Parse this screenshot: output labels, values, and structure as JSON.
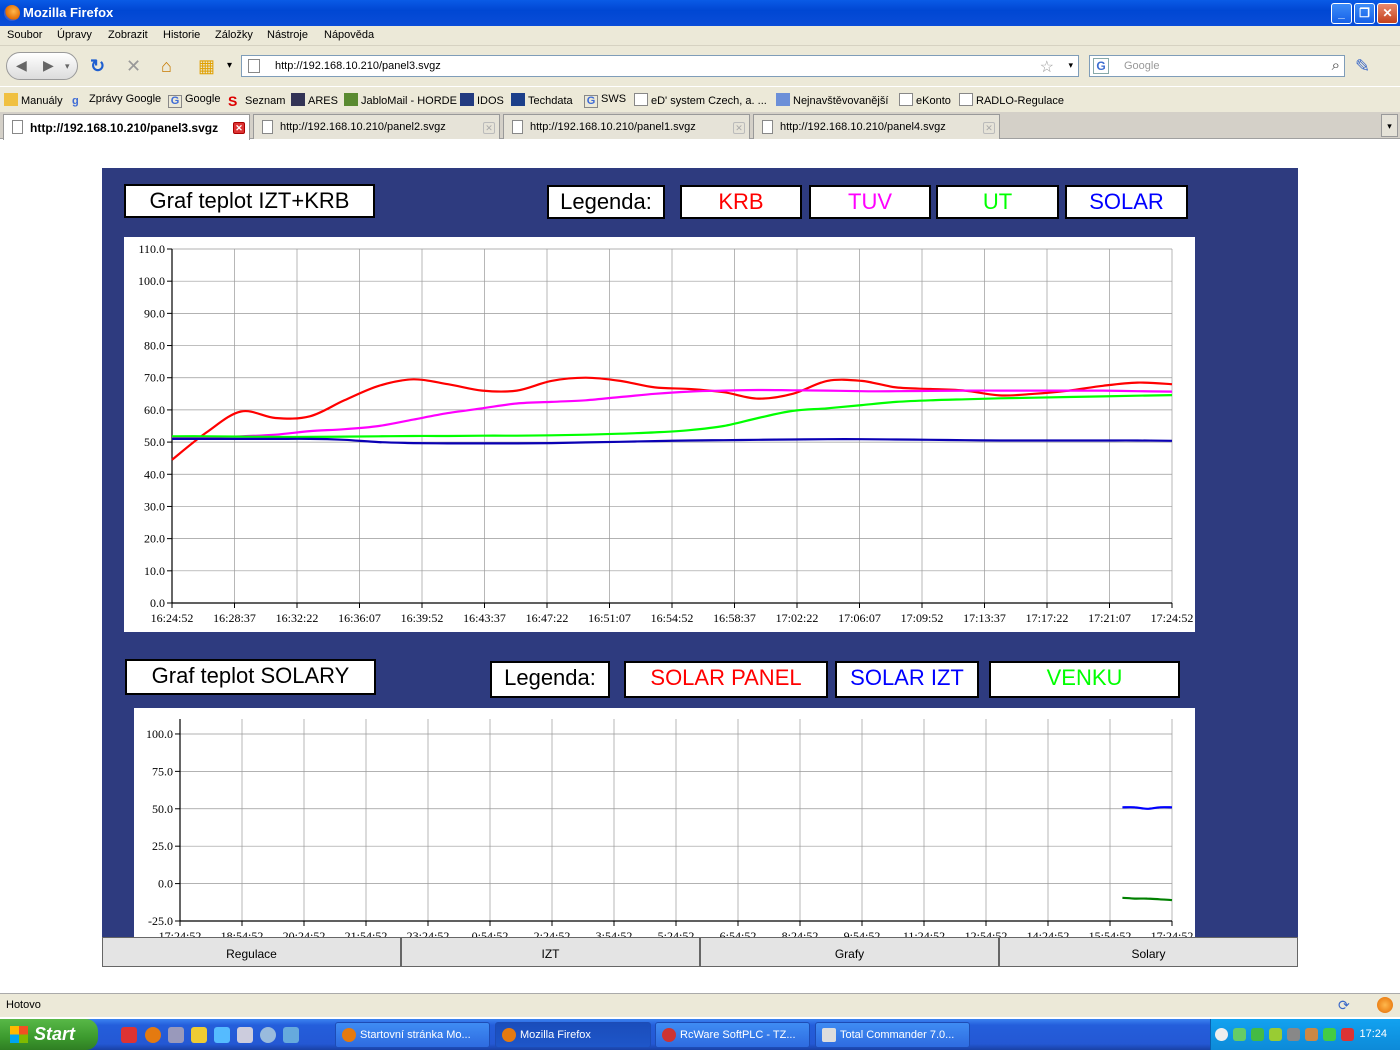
{
  "window": {
    "title": "Mozilla Firefox"
  },
  "menu": [
    "Soubor",
    "Úpravy",
    "Zobrazit",
    "Historie",
    "Záložky",
    "Nástroje",
    "Nápověda"
  ],
  "address": {
    "url": "http://192.168.10.210/panel3.svgz",
    "search_placeholder": "Google"
  },
  "bookmarks": [
    "Manuály",
    "Zprávy Google",
    "Google",
    "Seznam",
    "ARES",
    "JabloMail - HORDE",
    "IDOS",
    "Techdata",
    "SWS",
    "eD' system Czech, a. ...",
    "Nejnavštěvovanější",
    "eKonto",
    "RADLO-Regulace"
  ],
  "tabs": [
    {
      "label": "http://192.168.10.210/panel3.svgz",
      "active": true
    },
    {
      "label": "http://192.168.10.210/panel2.svgz",
      "active": false
    },
    {
      "label": "http://192.168.10.210/panel1.svgz",
      "active": false
    },
    {
      "label": "http://192.168.10.210/panel4.svgz",
      "active": false
    }
  ],
  "page": {
    "chart1_title": "Graf teplot IZT+KRB",
    "chart2_title": "Graf teplot SOLARY",
    "legend_label": "Legenda:",
    "legend1": [
      {
        "label": "KRB",
        "color": "#ff0000"
      },
      {
        "label": "TUV",
        "color": "#ff00ff"
      },
      {
        "label": "UT",
        "color": "#00ff00"
      },
      {
        "label": "SOLAR",
        "color": "#0000ff"
      }
    ],
    "legend2": [
      {
        "label": "SOLAR PANEL",
        "color": "#ff0000"
      },
      {
        "label": "SOLAR IZT",
        "color": "#0000ff"
      },
      {
        "label": "VENKU",
        "color": "#00ff00"
      }
    ],
    "nav": [
      "Regulace",
      "IZT",
      "Grafy",
      "Solary"
    ]
  },
  "status": {
    "text": "Hotovo"
  },
  "taskbar": {
    "start": "Start",
    "tasks": [
      "Startovní stránka Mo...",
      "Mozilla Firefox",
      "RcWare SoftPLC - TZ...",
      "Total Commander 7.0..."
    ],
    "clock": "17:24"
  },
  "chart_data": [
    {
      "type": "line",
      "title": "Graf teplot IZT+KRB",
      "x_ticks": [
        "16:24:52",
        "16:28:37",
        "16:32:22",
        "16:36:07",
        "16:39:52",
        "16:43:37",
        "16:47:22",
        "16:51:07",
        "16:54:52",
        "16:58:37",
        "17:02:22",
        "17:06:07",
        "17:09:52",
        "17:13:37",
        "17:17:22",
        "17:21:07",
        "17:24:52"
      ],
      "y_ticks": [
        "0.0",
        "10.0",
        "20.0",
        "30.0",
        "40.0",
        "50.0",
        "60.0",
        "70.0",
        "80.0",
        "90.0",
        "100.0",
        "110.0"
      ],
      "ylim": [
        0,
        110
      ],
      "grid": true,
      "series": [
        {
          "name": "KRB",
          "color": "#ff0000",
          "values": [
            44.5,
            53,
            59.5,
            57.5,
            58,
            63,
            67.5,
            69.5,
            68,
            66,
            66,
            69,
            70,
            69,
            67,
            66.5,
            65.5,
            63.5,
            65,
            69,
            69,
            67,
            66.5,
            66,
            64.5,
            65,
            66,
            67.5,
            68.5,
            68
          ]
        },
        {
          "name": "TUV",
          "color": "#ff00ff",
          "values": [
            51.5,
            51.5,
            51.8,
            52.3,
            53.4,
            54,
            55,
            57,
            59,
            60.5,
            62,
            62.5,
            63,
            64,
            65,
            65.7,
            66,
            66.2,
            66.1,
            66,
            65.8,
            65.8,
            65.9,
            66,
            66,
            66,
            66,
            66,
            65.8,
            65.7
          ]
        },
        {
          "name": "UT",
          "color": "#00ff00",
          "values": [
            51.8,
            51.8,
            51.7,
            51.6,
            51.6,
            51.7,
            51.8,
            51.9,
            51.9,
            52,
            52,
            52.1,
            52.3,
            52.6,
            53,
            53.7,
            55,
            57.5,
            59.7,
            60.5,
            61.5,
            62.5,
            63,
            63.3,
            63.6,
            63.8,
            64,
            64.2,
            64.4,
            64.6
          ]
        },
        {
          "name": "SOLAR",
          "color": "#0a00b4",
          "values": [
            51,
            51,
            51,
            51,
            51,
            50.7,
            50,
            49.7,
            49.6,
            49.6,
            49.6,
            49.7,
            49.9,
            50.1,
            50.3,
            50.5,
            50.6,
            50.7,
            50.8,
            50.9,
            50.9,
            50.8,
            50.7,
            50.6,
            50.5,
            50.5,
            50.5,
            50.5,
            50.5,
            50.4
          ]
        }
      ]
    },
    {
      "type": "line",
      "title": "Graf teplot SOLARY",
      "x_ticks": [
        "17:24:52",
        "18:54:52",
        "20:24:52",
        "21:54:52",
        "23:24:52",
        "0:54:52",
        "2:24:52",
        "3:54:52",
        "5:24:52",
        "6:54:52",
        "8:24:52",
        "9:54:52",
        "11:24:52",
        "12:54:52",
        "14:24:52",
        "15:54:52",
        "17:24:52"
      ],
      "y_ticks": [
        "-25.0",
        "0.0",
        "25.0",
        "50.0",
        "75.0",
        "100.0"
      ],
      "ylim": [
        -25,
        110
      ],
      "grid": true,
      "series": [
        {
          "name": "SOLAR IZT",
          "color": "#0000ff",
          "x": [
            15.2,
            15.4,
            15.6,
            15.8,
            16.0
          ],
          "values": [
            51,
            51,
            50,
            51,
            51
          ]
        },
        {
          "name": "VENKU",
          "color": "#008000",
          "x": [
            15.2,
            15.4,
            15.6,
            15.8,
            16.0
          ],
          "values": [
            -9.5,
            -10,
            -10,
            -10.5,
            -11
          ]
        }
      ]
    }
  ]
}
